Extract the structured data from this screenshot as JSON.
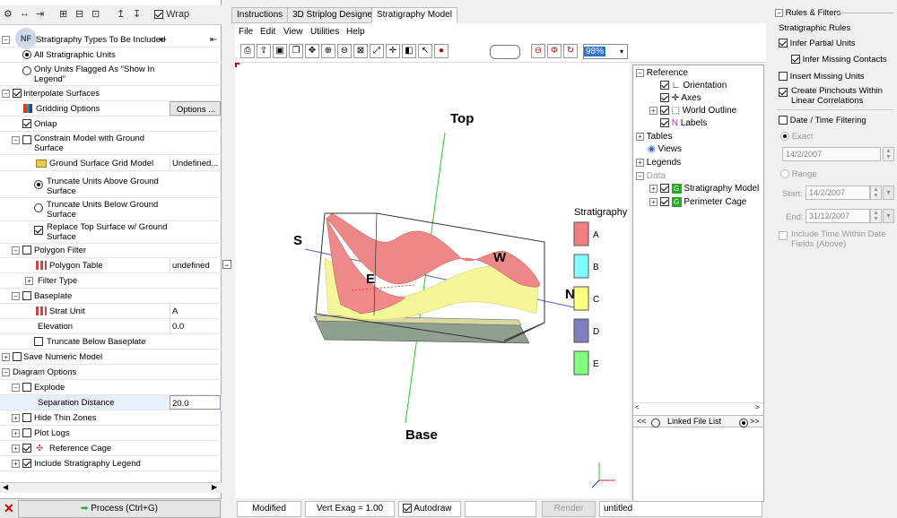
{
  "toolbar": {
    "wrap_label": "Wrap"
  },
  "avatar": {
    "initials": "NF"
  },
  "left_rows": [
    {
      "label": "Stratigraphy Types To Be Included",
      "value": "",
      "pin": true
    },
    {
      "label": "All Stratigraphic Units",
      "value": ""
    },
    {
      "label": "Only Units Flagged As \"Show In Legend\"",
      "value": ""
    },
    {
      "label": "Interpolate Surfaces",
      "value": ""
    },
    {
      "label": "Gridding Options",
      "value": "Options ..."
    },
    {
      "label": "Onlap",
      "value": ""
    },
    {
      "label": "Constrain Model with Ground Surface",
      "value": ""
    },
    {
      "label": "Ground Surface Grid Model",
      "value": "Undefined..."
    },
    {
      "label": "Truncate Units Above Ground Surface",
      "value": ""
    },
    {
      "label": "Truncate Units Below Ground Surface",
      "value": ""
    },
    {
      "label": "Replace Top Surface w/ Ground Surface",
      "value": ""
    },
    {
      "label": "Polygon Filter",
      "value": ""
    },
    {
      "label": "Polygon Table",
      "value": "undefined"
    },
    {
      "label": "Filter Type",
      "value": ""
    },
    {
      "label": "Baseplate",
      "value": ""
    },
    {
      "label": "Strat Unit",
      "value": "A"
    },
    {
      "label": "Elevation",
      "value": "0.0"
    },
    {
      "label": "Truncate Below Baseplate",
      "value": ""
    },
    {
      "label": "Save Numeric Model",
      "value": ""
    },
    {
      "label": "Diagram Options",
      "value": ""
    },
    {
      "label": "Explode",
      "value": ""
    },
    {
      "label": "Separation Distance",
      "value": "20.0"
    },
    {
      "label": "Hide Thin Zones",
      "value": ""
    },
    {
      "label": "Plot Logs",
      "value": ""
    },
    {
      "label": "Reference Cage",
      "value": ""
    },
    {
      "label": "Include Stratigraphy Legend",
      "value": ""
    }
  ],
  "process_label": "Process (Ctrl+G)",
  "tabs": [
    "Instructions",
    "3D Striplog Designer",
    "Stratigraphy Model"
  ],
  "menu": [
    "File",
    "Edit",
    "View",
    "Utilities",
    "Help"
  ],
  "zoom": "98%",
  "viewer": {
    "labels": {
      "top": "Top",
      "base": "Base",
      "s": "S",
      "e": "E",
      "w": "W",
      "n": "N"
    },
    "legend_title": "Stratigraphy",
    "legend": [
      {
        "name": "A",
        "color": "#f08080"
      },
      {
        "name": "B",
        "color": "#80ffff"
      },
      {
        "name": "C",
        "color": "#ffff80"
      },
      {
        "name": "D",
        "color": "#7f7fbf"
      },
      {
        "name": "E",
        "color": "#80ff80"
      }
    ]
  },
  "tree": {
    "reference": "Reference",
    "orientation": "Orientation",
    "axes": "Axes",
    "world_outline": "World Outline",
    "labels": "Labels",
    "tables": "Tables",
    "views": "Views",
    "legends": "Legends",
    "data": "Data",
    "strat_model": "Stratigraphy Model",
    "perimeter": "Perimeter Cage",
    "linked_file_list": "Linked File List",
    "nav_prev": "<<",
    "nav_next": ">>"
  },
  "status": {
    "modified": "Modified",
    "vert_exag": "Vert Exag = 1.00",
    "autodraw": "Autodraw",
    "render": "Render",
    "filename": "untitled"
  },
  "right": {
    "rules_filters": "Rules & Filters",
    "strat_rules": "Stratigraphic Rules",
    "infer_partial": "Infer Partial Units",
    "infer_missing": "Infer Missing Contacts",
    "insert_missing": "Insert Missing Units",
    "create_pinchouts": "Create Pinchouts Within Linear Correlations",
    "date_time": "Date / Time Filtering",
    "exact": "Exact",
    "exact_date": "14/2/2007",
    "range": "Range",
    "start_label": "Start:",
    "start_date": "14/2/2007",
    "end_label": "End:",
    "end_date": "31/12/2007",
    "include_time": "Include Time Within Date Fields (Above)"
  }
}
